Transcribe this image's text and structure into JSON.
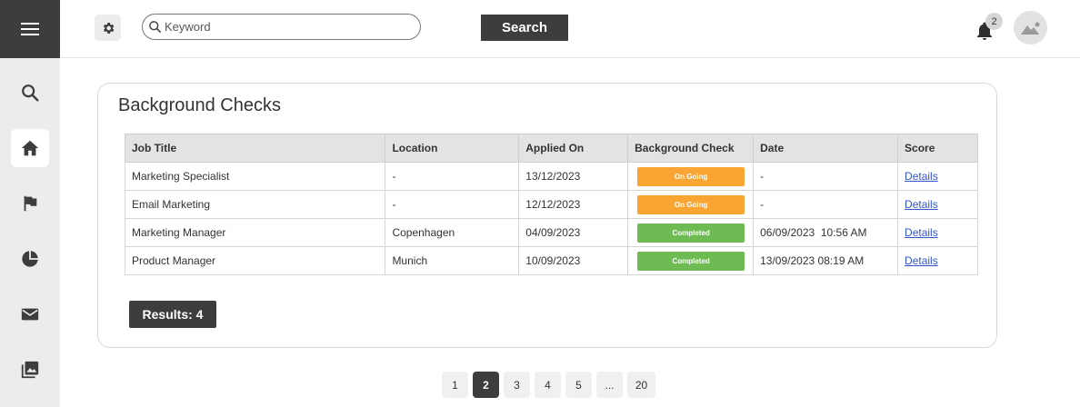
{
  "header": {
    "search_placeholder": "Keyword",
    "search_label": "Search",
    "notification_count": "2"
  },
  "card": {
    "title": "Background Checks",
    "columns": [
      "Job Title",
      "Location",
      "Applied On",
      "Background Check",
      "Date",
      "Score"
    ],
    "rows": [
      {
        "job_title": "Marketing Specialist",
        "location": "-",
        "applied_on": "13/12/2023",
        "status": "On Going",
        "date": "-",
        "score": "Details"
      },
      {
        "job_title": "Email Marketing",
        "location": "-",
        "applied_on": "12/12/2023",
        "status": "On Going",
        "date": "-",
        "score": "Details"
      },
      {
        "job_title": "Marketing Manager",
        "location": "Copenhagen",
        "applied_on": "04/09/2023",
        "status": "Completed",
        "date": "06/09/2023  10:56 AM",
        "score": "Details"
      },
      {
        "job_title": "Product Manager",
        "location": "Munich",
        "applied_on": "10/09/2023",
        "status": "Completed",
        "date": "13/09/2023 08:19 AM",
        "score": "Details"
      }
    ],
    "results_label": "Results: 4"
  },
  "pagination": {
    "pages": [
      "1",
      "2",
      "3",
      "4",
      "5",
      "...",
      "20"
    ],
    "current": "2"
  },
  "colors": {
    "ongoing": "#f9a533",
    "completed": "#6fbb53",
    "dark": "#3d3d3d"
  }
}
